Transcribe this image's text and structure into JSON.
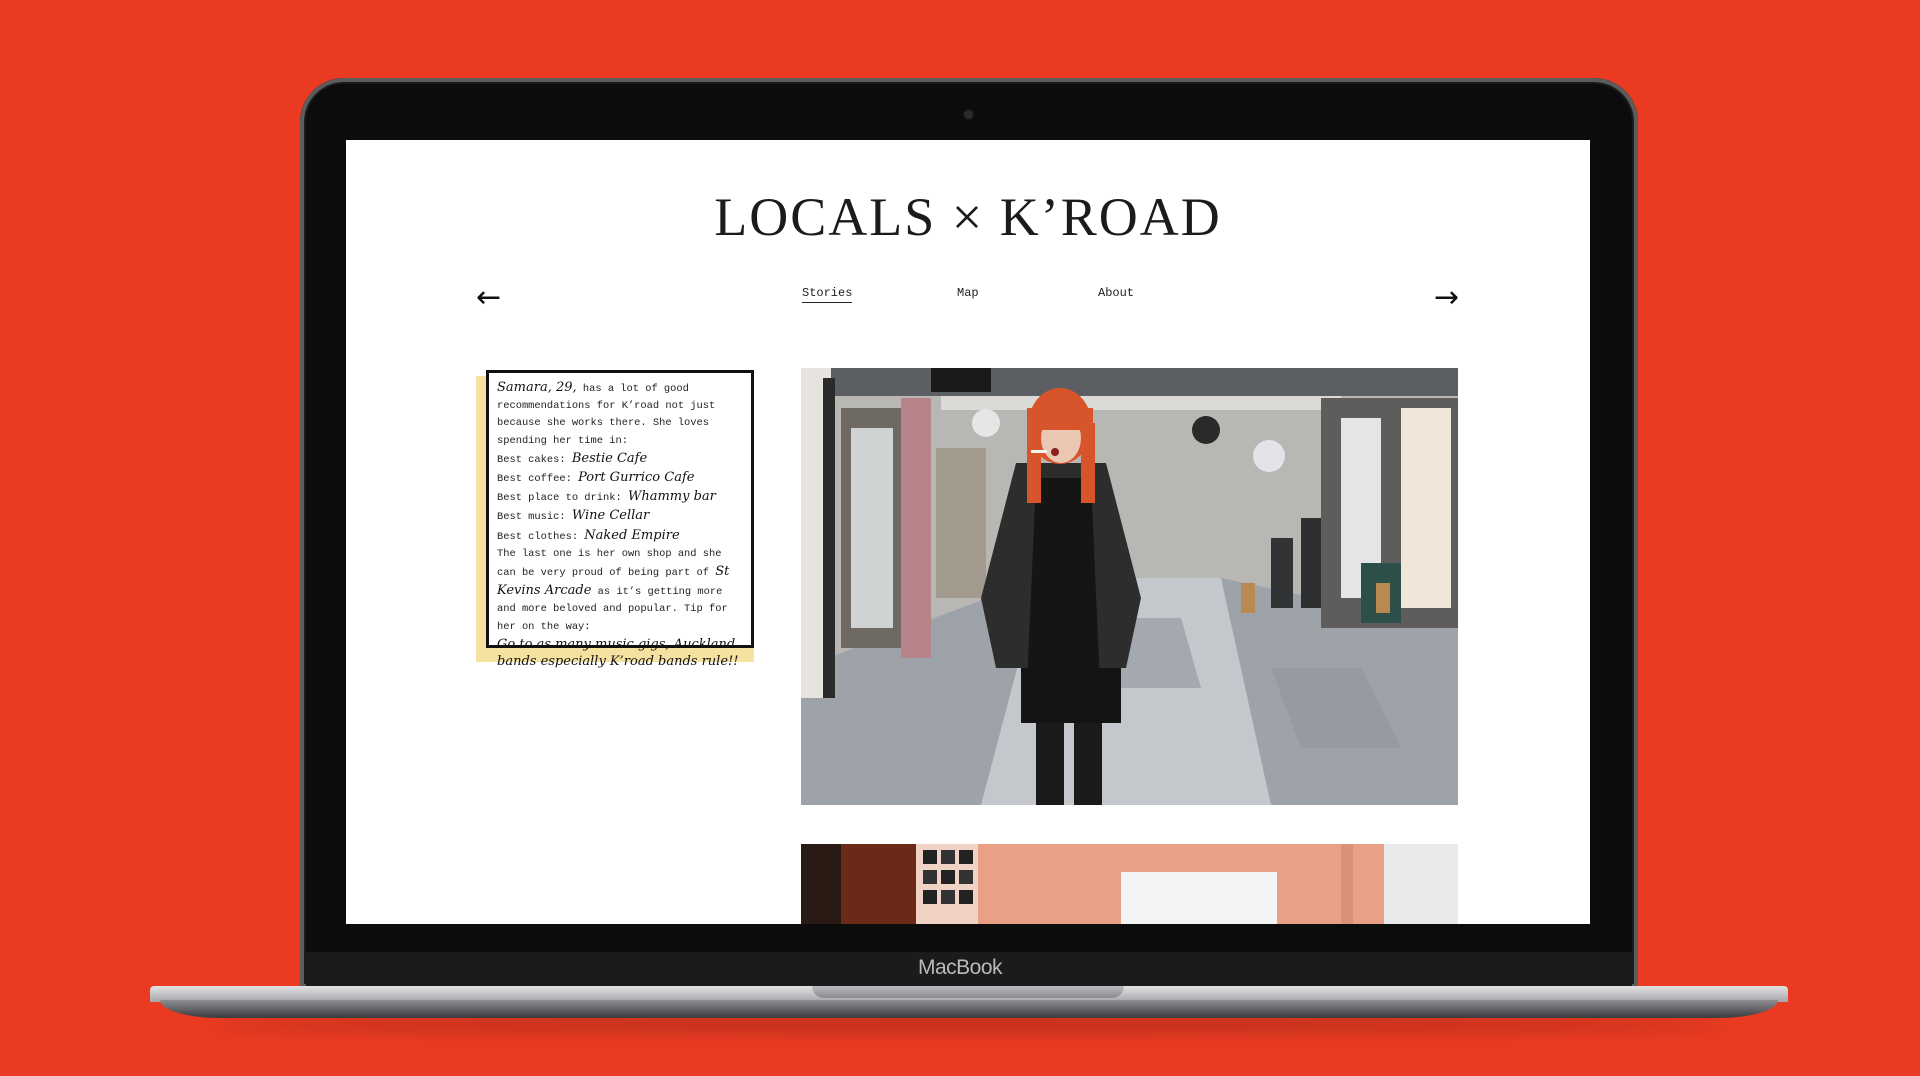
{
  "site": {
    "title": "LOCALS × K’ROAD"
  },
  "nav": {
    "prev_icon": "arrow-left-icon",
    "next_icon": "arrow-right-icon",
    "items": [
      {
        "label": "Stories",
        "active": true
      },
      {
        "label": "Map",
        "active": false
      },
      {
        "label": "About",
        "active": false
      }
    ]
  },
  "story": {
    "name": "Samara, 29,",
    "intro": " has a lot of good recommendations for K’road not just because she works there. She loves spending her time in:",
    "best": [
      {
        "label": "Best cakes: ",
        "value": "Bestie Cafe"
      },
      {
        "label": "Best coffee: ",
        "value": "Port Gurrico Cafe"
      },
      {
        "label": "Best place to drink: ",
        "value": "Whammy bar"
      },
      {
        "label": "Best music: ",
        "value": "Wine Cellar"
      },
      {
        "label": "Best clothes: ",
        "value": "Naked Empire"
      }
    ],
    "outro_a": "The last one is her own shop and she can be very proud of being part of ",
    "outro_hand": "St Kevins Arcade",
    "outro_b": " as it’s getting more and more beloved and popular. Tip for her on the way:",
    "tip": "Go to as many music gigs, Auckland bands especially K’road bands rule!!"
  },
  "device": {
    "brand": "MacBook"
  },
  "colors": {
    "background": "#ea3b22",
    "note_shadow": "#f6e2a0",
    "hair": "#d8542a"
  }
}
